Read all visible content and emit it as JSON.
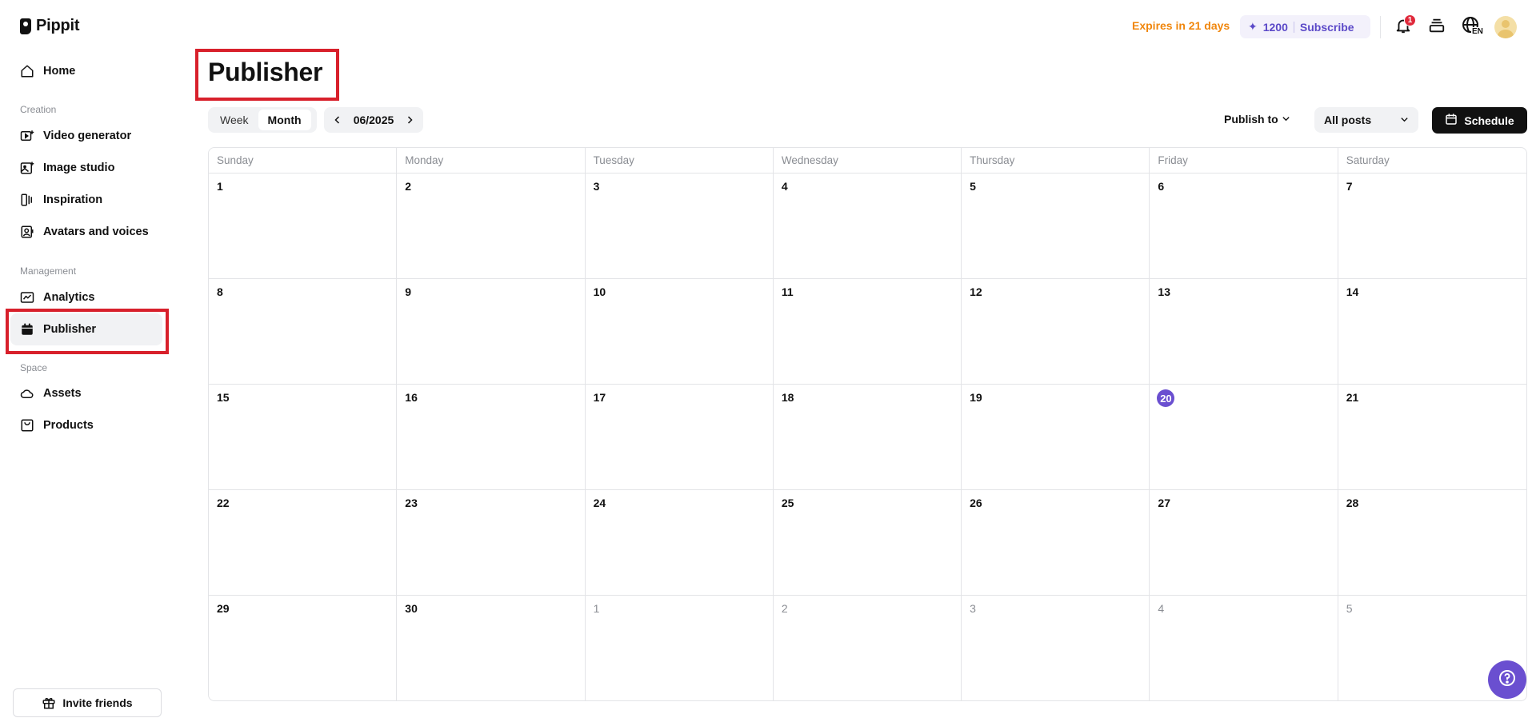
{
  "app": {
    "name": "Pippit"
  },
  "sidebar": {
    "items": [
      {
        "label": "Home",
        "icon": "home-icon"
      },
      {
        "label": "Video generator",
        "icon": "video-plus-icon"
      },
      {
        "label": "Image studio",
        "icon": "image-plus-icon"
      },
      {
        "label": "Inspiration",
        "icon": "inspiration-icon"
      },
      {
        "label": "Avatars and voices",
        "icon": "avatar-icon"
      },
      {
        "label": "Analytics",
        "icon": "analytics-icon"
      },
      {
        "label": "Publisher",
        "icon": "calendar-icon",
        "active": true
      },
      {
        "label": "Assets",
        "icon": "cloud-icon"
      },
      {
        "label": "Products",
        "icon": "bag-icon"
      }
    ],
    "sections": [
      "Creation",
      "Management",
      "Space"
    ],
    "invite_label": "Invite friends"
  },
  "header": {
    "expires": "Expires in 21 days",
    "credits": "1200",
    "subscribe": "Subscribe",
    "notification_count": "1",
    "language": "EN",
    "colors": {
      "expires": "#f0860c",
      "accent": "#5b49c8",
      "badge": "#e0293b"
    }
  },
  "page": {
    "title": "Publisher"
  },
  "toolbar": {
    "view_week": "Week",
    "view_month": "Month",
    "selected_view": "Month",
    "current_period": "06/2025",
    "publish_to": "Publish to",
    "filter": "All posts",
    "schedule": "Schedule"
  },
  "calendar": {
    "weekdays": [
      "Sunday",
      "Monday",
      "Tuesday",
      "Wednesday",
      "Thursday",
      "Friday",
      "Saturday"
    ],
    "days": [
      {
        "d": "1"
      },
      {
        "d": "2"
      },
      {
        "d": "3"
      },
      {
        "d": "4"
      },
      {
        "d": "5"
      },
      {
        "d": "6"
      },
      {
        "d": "7"
      },
      {
        "d": "8"
      },
      {
        "d": "9"
      },
      {
        "d": "10"
      },
      {
        "d": "11"
      },
      {
        "d": "12"
      },
      {
        "d": "13"
      },
      {
        "d": "14"
      },
      {
        "d": "15"
      },
      {
        "d": "16"
      },
      {
        "d": "17"
      },
      {
        "d": "18"
      },
      {
        "d": "19"
      },
      {
        "d": "20",
        "today": true
      },
      {
        "d": "21"
      },
      {
        "d": "22"
      },
      {
        "d": "23"
      },
      {
        "d": "24"
      },
      {
        "d": "25"
      },
      {
        "d": "26"
      },
      {
        "d": "27"
      },
      {
        "d": "28"
      },
      {
        "d": "29"
      },
      {
        "d": "30"
      },
      {
        "d": "1",
        "other": true
      },
      {
        "d": "2",
        "other": true
      },
      {
        "d": "3",
        "other": true
      },
      {
        "d": "4",
        "other": true
      },
      {
        "d": "5",
        "other": true
      }
    ],
    "today_color": "#6a4fd0"
  }
}
